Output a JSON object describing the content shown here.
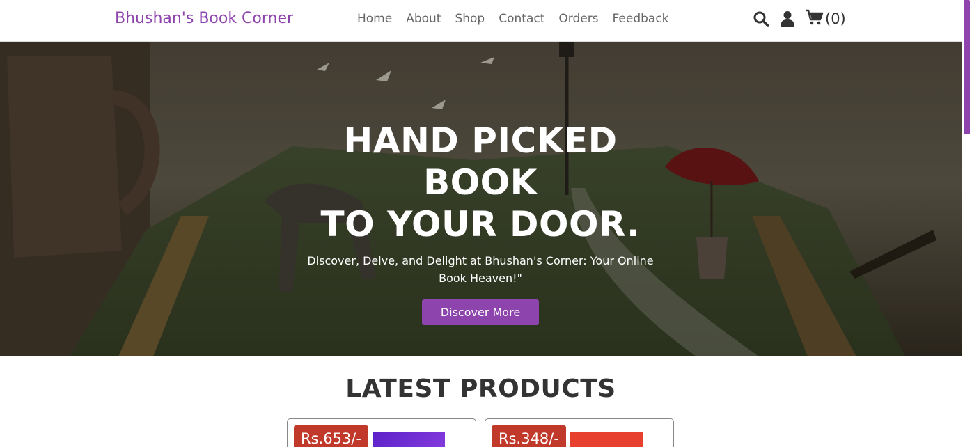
{
  "header": {
    "logo": "Bhushan's Book Corner",
    "nav": [
      "Home",
      "About",
      "Shop",
      "Contact",
      "Orders",
      "Feedback"
    ],
    "icons": [
      "search-icon",
      "user-icon",
      "cart-icon"
    ],
    "cart_count": "(0)"
  },
  "hero": {
    "title_line1": "HAND PICKED BOOK",
    "title_line2": "TO YOUR DOOR.",
    "subtitle": "Discover, Delve, and Delight at Bhushan's Corner: Your Online Book Heaven!\"",
    "button_label": "Discover More"
  },
  "products": {
    "title": "LATEST PRODUCTS",
    "items": [
      {
        "price": "Rs.653/-"
      },
      {
        "price": "Rs.348/-"
      }
    ]
  },
  "colors": {
    "accent": "#8e44ad",
    "price_badge": "#c0392b",
    "text_dark": "#333333"
  }
}
